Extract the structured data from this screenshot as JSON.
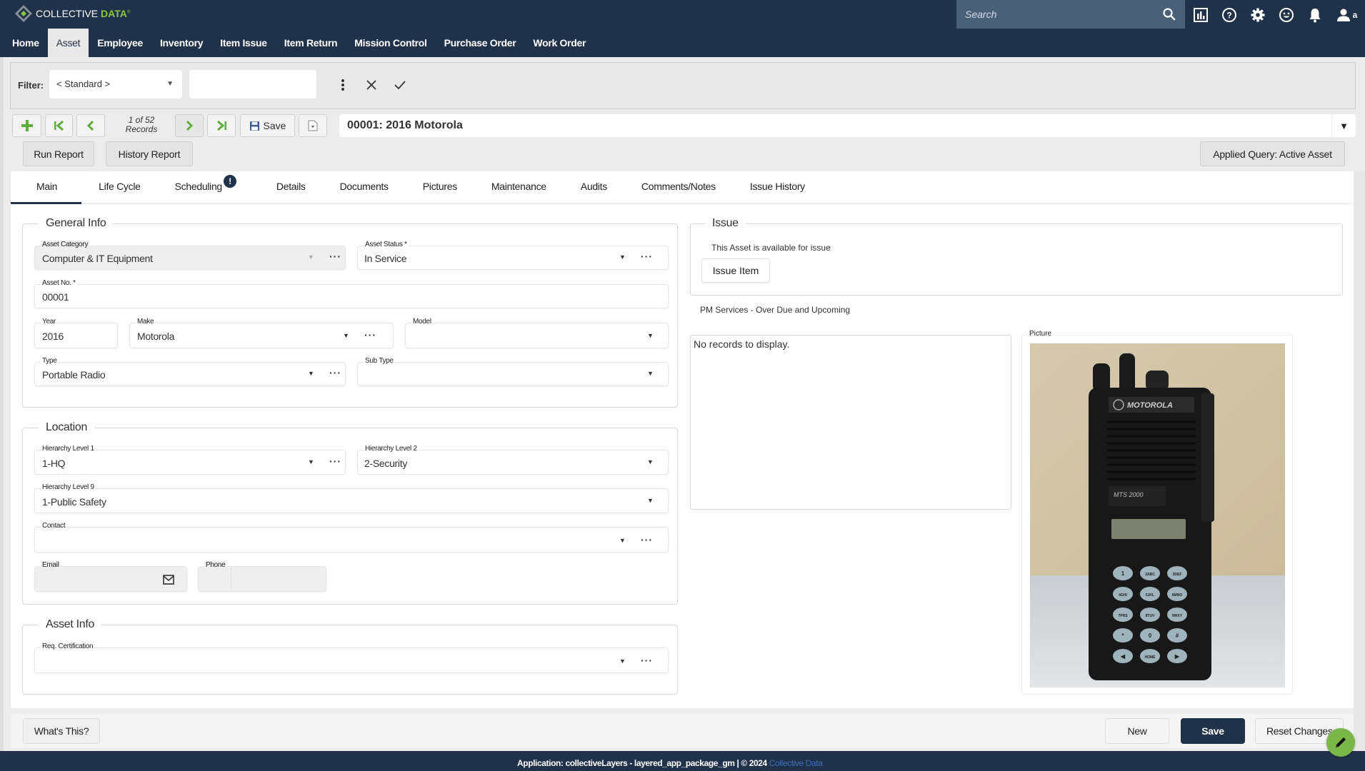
{
  "app": {
    "brand_main": "COLLECTIVE ",
    "brand_accent": "DATA",
    "brand_mark": "®"
  },
  "header": {
    "search_placeholder": "Search",
    "icons": [
      "dashboard-icon",
      "help-icon",
      "settings-icon",
      "feedback-icon",
      "notifications-icon",
      "user-icon"
    ],
    "user_initial": "a"
  },
  "nav": {
    "items": [
      {
        "label": "Home"
      },
      {
        "label": "Asset",
        "active": true
      },
      {
        "label": "Employee"
      },
      {
        "label": "Inventory"
      },
      {
        "label": "Item Issue"
      },
      {
        "label": "Item Return"
      },
      {
        "label": "Mission Control"
      },
      {
        "label": "Purchase Order"
      },
      {
        "label": "Work Order"
      }
    ]
  },
  "filter": {
    "label": "Filter:",
    "selected": "< Standard >",
    "input_value": ""
  },
  "record_toolbar": {
    "count_line1": "1 of 52",
    "count_line2": "Records",
    "save_label": "Save",
    "current_record": "00001: 2016 Motorola",
    "run_report": "Run Report",
    "history_report": "History Report",
    "applied_query": "Applied Query: Active Asset"
  },
  "tabs": [
    {
      "label": "Main",
      "active": true
    },
    {
      "label": "Life Cycle"
    },
    {
      "label": "Scheduling",
      "badge": "!"
    },
    {
      "label": "Details"
    },
    {
      "label": "Documents"
    },
    {
      "label": "Pictures"
    },
    {
      "label": "Maintenance"
    },
    {
      "label": "Audits"
    },
    {
      "label": "Comments/Notes"
    },
    {
      "label": "Issue History"
    }
  ],
  "general_info": {
    "title": "General Info",
    "asset_category": {
      "label": "Asset Category",
      "value": "Computer & IT Equipment"
    },
    "asset_status": {
      "label": "Asset Status *",
      "value": "In Service"
    },
    "asset_no": {
      "label": "Asset No. *",
      "value": "00001"
    },
    "year": {
      "label": "Year",
      "value": "2016"
    },
    "make": {
      "label": "Make",
      "value": "Motorola"
    },
    "model": {
      "label": "Model",
      "value": ""
    },
    "type": {
      "label": "Type",
      "value": "Portable Radio"
    },
    "sub_type": {
      "label": "Sub Type",
      "value": ""
    }
  },
  "location": {
    "title": "Location",
    "hierarchy_1": {
      "label": "Hierarchy Level 1",
      "value": "1-HQ"
    },
    "hierarchy_2": {
      "label": "Hierarchy Level 2",
      "value": "2-Security"
    },
    "hierarchy_9": {
      "label": "Hierarchy Level 9",
      "value": "1-Public Safety"
    },
    "contact": {
      "label": "Contact",
      "value": ""
    },
    "email": {
      "label": "Email",
      "value": ""
    },
    "phone": {
      "label": "Phone",
      "value": ""
    }
  },
  "asset_info": {
    "title": "Asset Info",
    "req_cert": {
      "label": "Req. Certification",
      "value": ""
    }
  },
  "issue": {
    "title": "Issue",
    "status_text": "This Asset is available for issue",
    "button": "Issue Item"
  },
  "pm_services": {
    "title": "PM Services - Over Due and Upcoming",
    "empty_text": "No records to display."
  },
  "picture": {
    "label": "Picture",
    "brand_text": "MOTOROLA",
    "model_text": "MTS 2000",
    "keypad": [
      "1",
      "2ABC",
      "3DEF",
      "4GHI",
      "5JKL",
      "6MNO",
      "7PRS",
      "8TUV",
      "9WXY",
      "*",
      "0",
      "#",
      "◀",
      "HOME",
      "▶"
    ]
  },
  "footer": {
    "whats_this": "What's This?",
    "new": "New",
    "save": "Save",
    "reset": "Reset Changes",
    "status_prefix": "Application: collectiveLayers - layered_app_package_gm | © 2024 ",
    "status_link": "Collective Data"
  },
  "colors": {
    "header_bg": "#1f3249",
    "accent_green": "#7ab648",
    "primary_button": "#1f3249"
  }
}
